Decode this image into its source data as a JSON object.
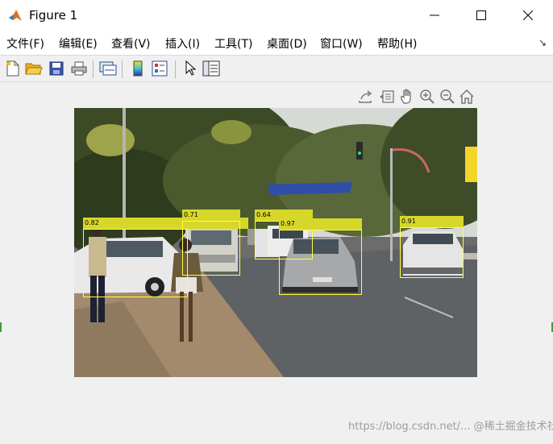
{
  "window": {
    "title": "Figure 1"
  },
  "menu": [
    {
      "label": "文件(F)"
    },
    {
      "label": "编辑(E)"
    },
    {
      "label": "查看(V)"
    },
    {
      "label": "插入(I)"
    },
    {
      "label": "工具(T)"
    },
    {
      "label": "桌面(D)"
    },
    {
      "label": "窗口(W)"
    },
    {
      "label": "帮助(H)"
    }
  ],
  "toolbar_icons": [
    "new-figure-icon",
    "open-file-icon",
    "save-icon",
    "print-icon",
    "link-plot-icon",
    "insert-colorbar-icon",
    "insert-legend-icon",
    "edit-plot-icon",
    "property-inspector-icon"
  ],
  "axes_toolbar_icons": [
    "export-icon",
    "brush-icon",
    "pan-icon",
    "zoom-in-icon",
    "zoom-out-icon",
    "restore-view-icon"
  ],
  "detections": [
    {
      "score": "0.82"
    },
    {
      "score": "0.71"
    },
    {
      "score": "0.64"
    },
    {
      "score": "0.97"
    },
    {
      "score": "0.91"
    }
  ],
  "colors": {
    "box": "#ffff40",
    "label_bg": "#d7d72a",
    "titlebar": "#ffffff",
    "toolbar": "#f0f0f0"
  },
  "watermark": "https://blog.csdn.net/... @稀土掘金技术社区"
}
